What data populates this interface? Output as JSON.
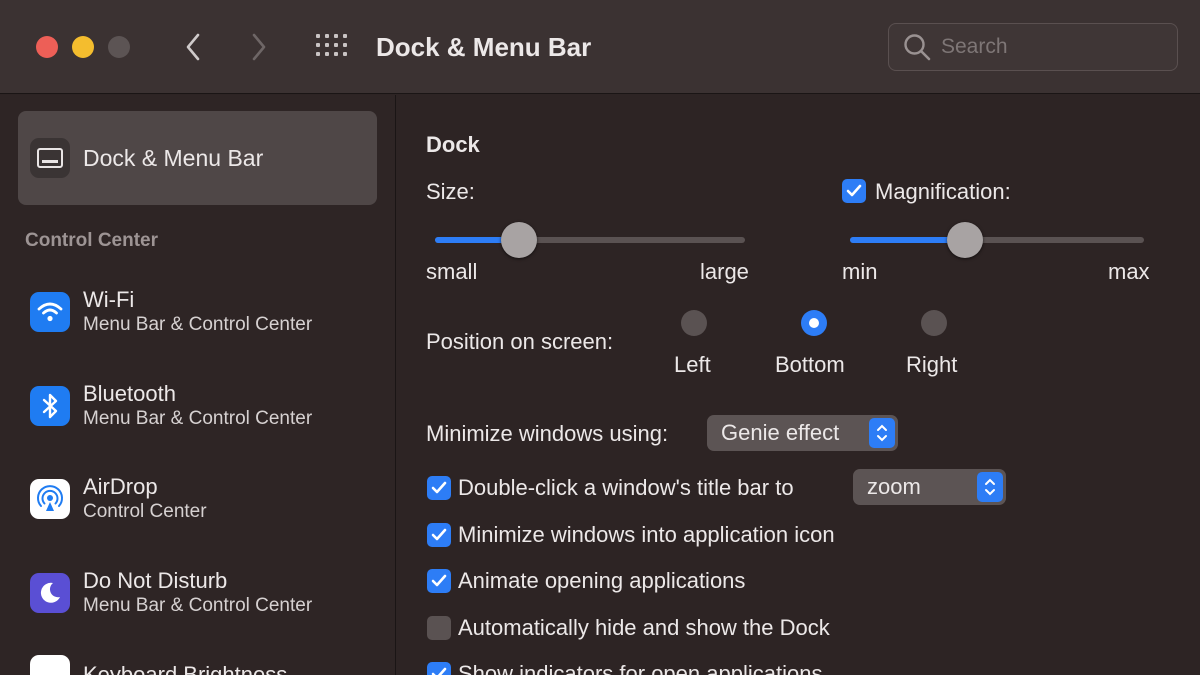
{
  "window": {
    "title": "Dock & Menu Bar"
  },
  "search": {
    "placeholder": "Search"
  },
  "sidebar": {
    "selected": {
      "label": "Dock & Menu Bar"
    },
    "section_title": "Control Center",
    "items": [
      {
        "title": "Wi-Fi",
        "subtitle": "Menu Bar & Control Center"
      },
      {
        "title": "Bluetooth",
        "subtitle": "Menu Bar & Control Center"
      },
      {
        "title": "AirDrop",
        "subtitle": "Control Center"
      },
      {
        "title": "Do Not Disturb",
        "subtitle": "Menu Bar & Control Center"
      },
      {
        "title": "Keyboard Brightness",
        "subtitle": ""
      }
    ]
  },
  "dock": {
    "heading": "Dock",
    "size": {
      "label": "Size:",
      "min_label": "small",
      "max_label": "large",
      "value": 0.27
    },
    "magnification": {
      "label": "Magnification:",
      "checked": true,
      "min_label": "min",
      "max_label": "max",
      "value": 0.39
    },
    "position": {
      "label": "Position on screen:",
      "options": [
        "Left",
        "Bottom",
        "Right"
      ],
      "selected": "Bottom"
    },
    "minimize": {
      "label": "Minimize windows using:",
      "value": "Genie effect"
    },
    "double_click": {
      "label": "Double-click a window's title bar to",
      "checked": true,
      "value": "zoom"
    },
    "options": [
      {
        "label": "Minimize windows into application icon",
        "checked": true
      },
      {
        "label": "Animate opening applications",
        "checked": true
      },
      {
        "label": "Automatically hide and show the Dock",
        "checked": false
      },
      {
        "label": "Show indicators for open applications",
        "checked": true
      }
    ]
  },
  "colors": {
    "accent": "#2d7df6",
    "background": "#2d2424",
    "sidebar_selected": "#4f4747"
  }
}
